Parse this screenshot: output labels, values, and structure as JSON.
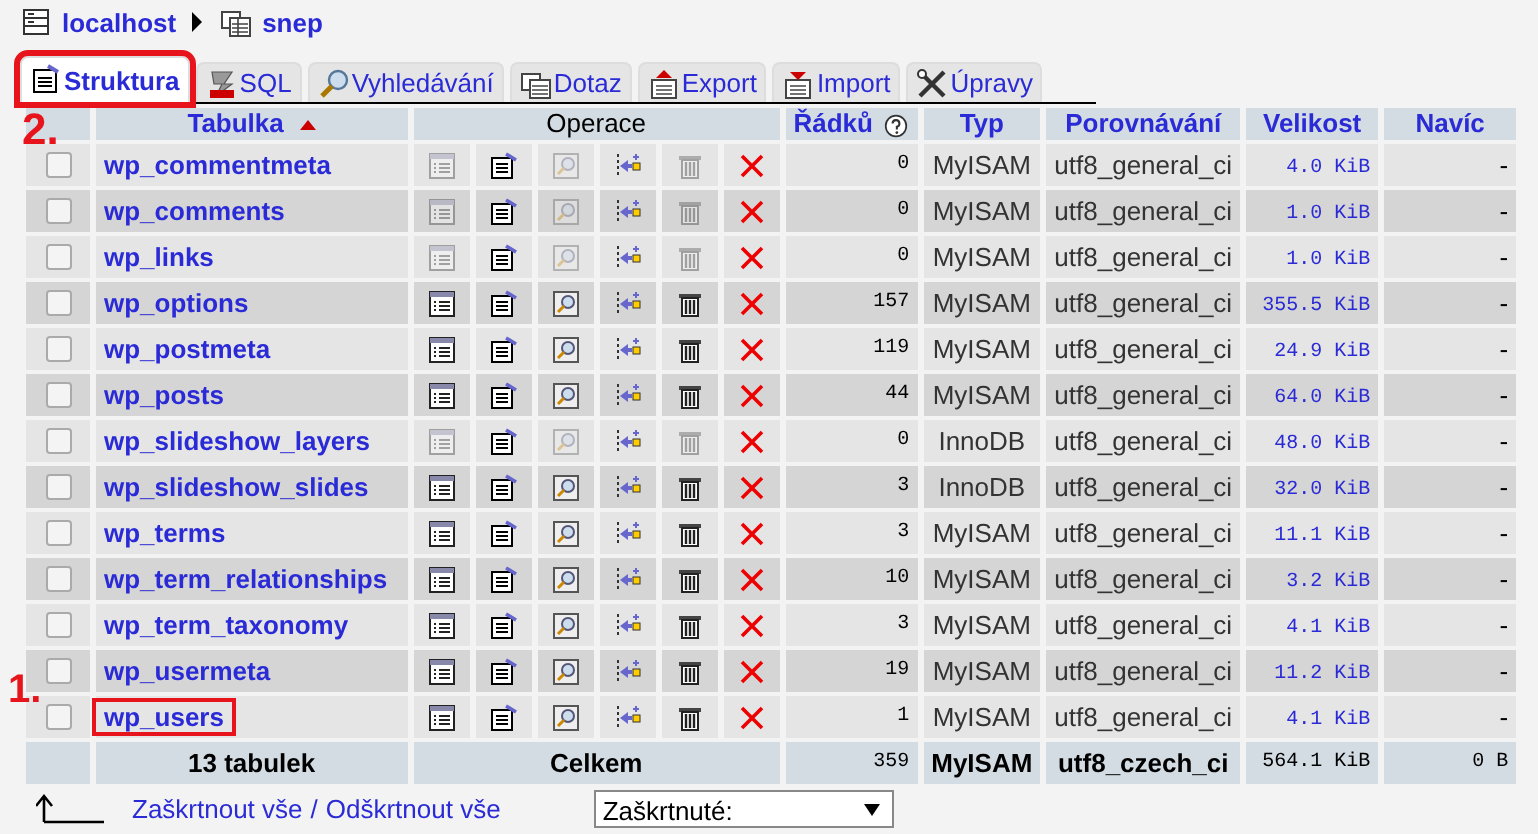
{
  "breadcrumb": [
    {
      "label": "localhost",
      "kind": "server"
    },
    {
      "label": "snep",
      "kind": "database"
    }
  ],
  "tabs": [
    {
      "label": "Struktura",
      "kind": "structure",
      "selected": true,
      "highlighted": true,
      "annotation": "2."
    },
    {
      "label": "SQL",
      "kind": "sql",
      "selected": false,
      "highlighted": false
    },
    {
      "label": "Vyhledávání",
      "kind": "search",
      "selected": false,
      "highlighted": false
    },
    {
      "label": "Dotaz",
      "kind": "query",
      "selected": false,
      "highlighted": false
    },
    {
      "label": "Export",
      "kind": "export",
      "selected": false,
      "highlighted": false
    },
    {
      "label": "Import",
      "kind": "import",
      "selected": false,
      "highlighted": false
    },
    {
      "label": "Úpravy",
      "kind": "tools",
      "selected": false,
      "highlighted": false
    }
  ],
  "columns": [
    {
      "label": "Tabulka",
      "sorted": true
    },
    {
      "label": "Operace"
    },
    {
      "label": "Řádků",
      "help": true
    },
    {
      "label": "Typ"
    },
    {
      "label": "Porovnávání"
    },
    {
      "label": "Velikost"
    },
    {
      "label": "Navíc"
    }
  ],
  "rows": [
    {
      "checked": false,
      "name": "wp_commentmeta",
      "empty": true,
      "highlighted": false,
      "rows": "0",
      "type": "MyISAM",
      "collation": "utf8_general_ci",
      "size": "4.0 KiB",
      "overhead": "-"
    },
    {
      "checked": false,
      "name": "wp_comments",
      "empty": true,
      "highlighted": false,
      "rows": "0",
      "type": "MyISAM",
      "collation": "utf8_general_ci",
      "size": "1.0 KiB",
      "overhead": "-"
    },
    {
      "checked": false,
      "name": "wp_links",
      "empty": true,
      "highlighted": false,
      "rows": "0",
      "type": "MyISAM",
      "collation": "utf8_general_ci",
      "size": "1.0 KiB",
      "overhead": "-"
    },
    {
      "checked": false,
      "name": "wp_options",
      "empty": false,
      "highlighted": false,
      "rows": "157",
      "type": "MyISAM",
      "collation": "utf8_general_ci",
      "size": "355.5 KiB",
      "overhead": "-"
    },
    {
      "checked": false,
      "name": "wp_postmeta",
      "empty": false,
      "highlighted": false,
      "rows": "119",
      "type": "MyISAM",
      "collation": "utf8_general_ci",
      "size": "24.9 KiB",
      "overhead": "-"
    },
    {
      "checked": false,
      "name": "wp_posts",
      "empty": false,
      "highlighted": false,
      "rows": "44",
      "type": "MyISAM",
      "collation": "utf8_general_ci",
      "size": "64.0 KiB",
      "overhead": "-"
    },
    {
      "checked": false,
      "name": "wp_slideshow_layers",
      "empty": true,
      "highlighted": false,
      "rows": "0",
      "type": "InnoDB",
      "collation": "utf8_general_ci",
      "size": "48.0 KiB",
      "overhead": "-"
    },
    {
      "checked": false,
      "name": "wp_slideshow_slides",
      "empty": false,
      "highlighted": false,
      "rows": "3",
      "type": "InnoDB",
      "collation": "utf8_general_ci",
      "size": "32.0 KiB",
      "overhead": "-"
    },
    {
      "checked": false,
      "name": "wp_terms",
      "empty": false,
      "highlighted": false,
      "rows": "3",
      "type": "MyISAM",
      "collation": "utf8_general_ci",
      "size": "11.1 KiB",
      "overhead": "-"
    },
    {
      "checked": false,
      "name": "wp_term_relationships",
      "empty": false,
      "highlighted": false,
      "rows": "10",
      "type": "MyISAM",
      "collation": "utf8_general_ci",
      "size": "3.2 KiB",
      "overhead": "-"
    },
    {
      "checked": false,
      "name": "wp_term_taxonomy",
      "empty": false,
      "highlighted": false,
      "rows": "3",
      "type": "MyISAM",
      "collation": "utf8_general_ci",
      "size": "4.1 KiB",
      "overhead": "-"
    },
    {
      "checked": false,
      "name": "wp_usermeta",
      "empty": false,
      "highlighted": false,
      "rows": "19",
      "type": "MyISAM",
      "collation": "utf8_general_ci",
      "size": "11.2 KiB",
      "overhead": "-"
    },
    {
      "checked": false,
      "name": "wp_users",
      "empty": false,
      "highlighted": true,
      "annotation": "1.",
      "rows": "1",
      "type": "MyISAM",
      "collation": "utf8_general_ci",
      "size": "4.1 KiB",
      "overhead": "-"
    }
  ],
  "footer": {
    "count": "13 tabulek",
    "label": "Celkem",
    "rows": "359",
    "type": "MyISAM",
    "collation": "utf8_czech_ci",
    "size": "564.1 KiB",
    "overhead": "0 B"
  },
  "actions": {
    "check_all": "Zaškrtnout vše",
    "separator": "/",
    "uncheck_all": "Odškrtnout vše",
    "select": {
      "value": "Zaškrtnuté:"
    }
  }
}
